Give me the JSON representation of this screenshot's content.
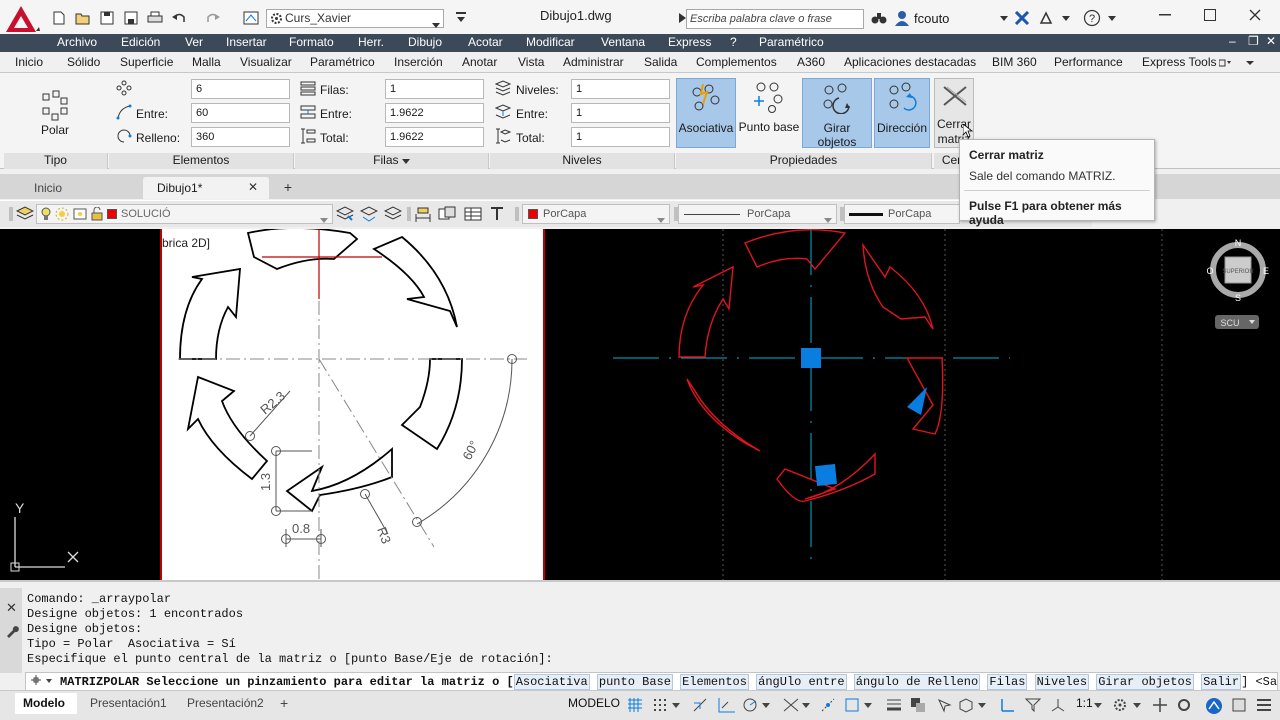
{
  "titlebar": {
    "app_letter": "A",
    "workspace": "Curs_Xavier",
    "document_title": "Dibujo1.dwg",
    "search_placeholder": "Escriba palabra clave o frase",
    "user": "fcouto",
    "help_icon": "?"
  },
  "menubar": [
    "Archivo",
    "Edición",
    "Ver",
    "Insertar",
    "Formato",
    "Herr.",
    "Dibujo",
    "Acotar",
    "Modificar",
    "Ventana",
    "Express",
    "?",
    "Paramétrico"
  ],
  "ribbon_tabs": [
    "Inicio",
    "Sólido",
    "Superficie",
    "Malla",
    "Visualizar",
    "Paramétrico",
    "Inserción",
    "Anotar",
    "Vista",
    "Administrar",
    "Salida",
    "Complementos",
    "A360",
    "Aplicaciones destacadas",
    "BIM 360",
    "Performance",
    "Express Tools"
  ],
  "ribbon": {
    "tipo": {
      "button_label": "Polar",
      "panel_title": "Tipo"
    },
    "elementos": {
      "panel_title": "Elementos",
      "count_value": "6",
      "entre_label": "Entre:",
      "entre_value": "60",
      "relleno_label": "Relleno:",
      "relleno_value": "360"
    },
    "filas": {
      "panel_title": "Filas",
      "filas_label": "Filas:",
      "filas_value": "1",
      "entre_label": "Entre:",
      "entre_value": "1.9622",
      "total_label": "Total:",
      "total_value": "1.9622"
    },
    "niveles": {
      "panel_title": "Niveles",
      "niveles_label": "Niveles:",
      "niveles_value": "1",
      "entre_label": "Entre:",
      "entre_value": "1",
      "total_label": "Total:",
      "total_value": "1"
    },
    "propiedades": {
      "panel_title": "Propiedades",
      "asociativa": "Asociativa",
      "punto_base": "Punto base",
      "girar_objetos": "Girar objetos",
      "direccion": "Dirección"
    },
    "cerrar": {
      "label_line1": "Cerrar",
      "label_line2": "matriz",
      "panel_title": "Cerr"
    }
  },
  "tooltip": {
    "title": "Cerrar matriz",
    "description": "Sale del comando MATRIZ.",
    "help": "Pulse F1 para obtener más ayuda"
  },
  "doc_tabs": {
    "start": "Inicio",
    "active": "Dibujo1*"
  },
  "layerbar": {
    "layer": "SOLUCIÓ",
    "color": "PorCapa",
    "linetype": "PorCapa",
    "lineweight": "PorCapa"
  },
  "drawing": {
    "ref_label": "brica 2D]",
    "dims": {
      "r23": "R2.3",
      "d13": "1.3",
      "d08": "0.8",
      "r3": "R3",
      "a60": "60°"
    },
    "viewcube": {
      "n": "N",
      "s": "S",
      "e": "E",
      "o": "O",
      "face": "SUPERIOR",
      "ucs": "SCU"
    },
    "ucs_y": "Y"
  },
  "command": {
    "history": [
      "Comando: _arraypolar",
      "Designe objetos: 1 encontrados",
      "Designe objetos:",
      "Tipo = Polar  Asociativa = Sí",
      "Especifique el punto central de la matriz o [punto Base/Eje de rotación]:"
    ],
    "prompt_text": "MATRIZPOLAR Seleccione un pinzamiento para editar la matriz o [",
    "options": [
      "Asociativa",
      "punto Base",
      "Elementos",
      "ángUlo entre",
      "ángulo de Relleno",
      "Filas",
      "Niveles",
      "Girar objetos",
      "Salir"
    ],
    "prompt_end": "] <Salir>:"
  },
  "status": {
    "tabs": [
      "Modelo",
      "Presentación1",
      "Presentación2"
    ],
    "model_label": "MODELO",
    "scale": "1:1"
  },
  "colors": {
    "menubar": "#3c4958",
    "accent_blue": "#0a7ee0",
    "draw_red": "#e0141e",
    "draw_cyan": "#00b4d2"
  }
}
